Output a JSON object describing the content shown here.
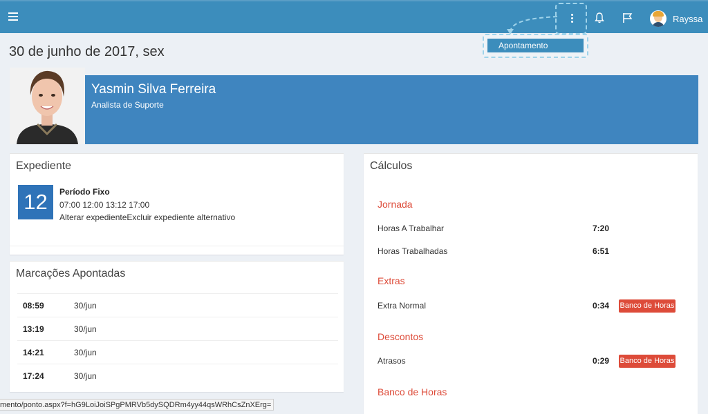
{
  "topbar": {
    "username": "Rayssa",
    "bg_color": "#3c8dbc"
  },
  "dropdown": {
    "item_label": "Apontamento"
  },
  "page": {
    "date": "30 de junho de 2017, sex"
  },
  "profile": {
    "name": "Yasmin Silva Ferreira",
    "role": "Analista de Suporte"
  },
  "expediente": {
    "title": "Expediente",
    "day": "12",
    "period_title": "Período Fixo",
    "times": "07:00 12:00 13:12 17:00",
    "links": "Alterar expedienteExcluir expediente alternativo"
  },
  "marcacoes": {
    "title": "Marcações Apontadas",
    "rows": [
      {
        "time": "08:59",
        "date": "30/jun"
      },
      {
        "time": "13:19",
        "date": "30/jun"
      },
      {
        "time": "14:21",
        "date": "30/jun"
      },
      {
        "time": "17:24",
        "date": "30/jun"
      }
    ]
  },
  "calculos": {
    "title": "Cálculos",
    "sections": {
      "jornada": "Jornada",
      "extras": "Extras",
      "descontos": "Descontos",
      "banco": "Banco de Horas"
    },
    "rows": {
      "horas_a_trabalhar": {
        "label": "Horas A Trabalhar",
        "value": "7:20"
      },
      "horas_trabalhadas": {
        "label": "Horas Trabalhadas",
        "value": "6:51"
      },
      "extra_normal": {
        "label": "Extra Normal",
        "value": "0:34",
        "badge": "Banco de Horas"
      },
      "atrasos": {
        "label": "Atrasos",
        "value": "0:29",
        "badge": "Banco de Horas"
      }
    },
    "accent_color": "#dd4b39"
  },
  "statusbar": {
    "url": "mento/ponto.aspx?f=hG9LoiJoiSPgPMRVb5dySQDRm4yy44qsWRhCsZnXErg="
  }
}
